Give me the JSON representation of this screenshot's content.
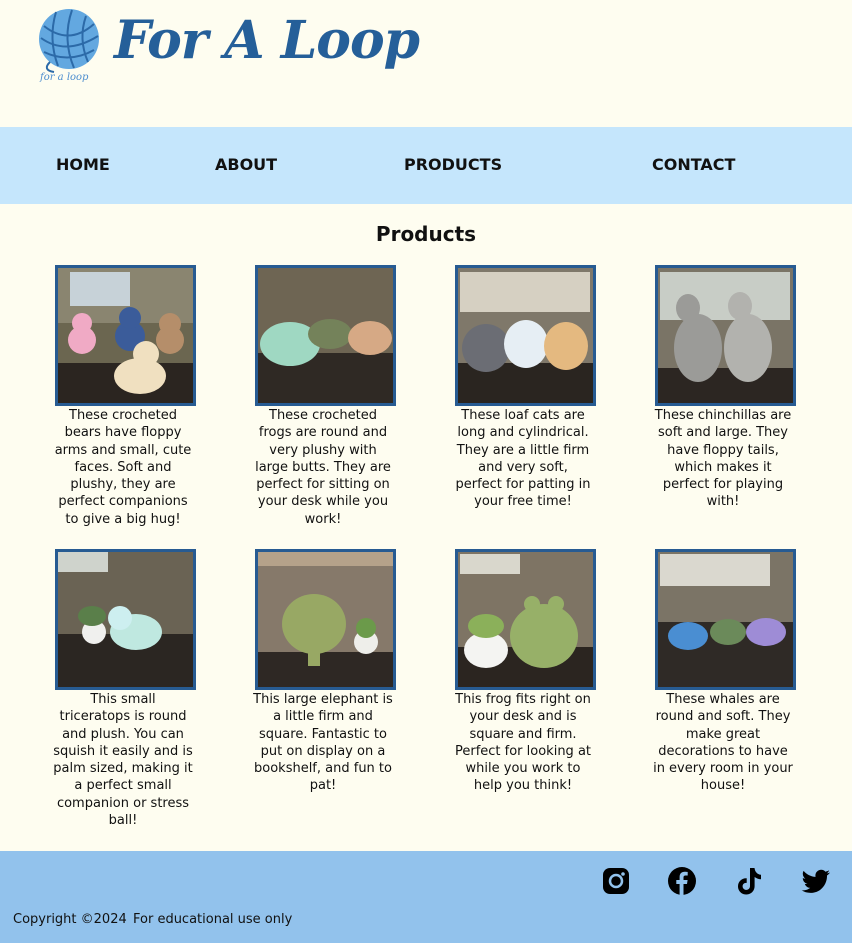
{
  "brand": {
    "name": "For A Loop",
    "logo_text": "for a loop"
  },
  "nav": {
    "home": "HOME",
    "about": "ABOUT",
    "products": "PRODUCTS",
    "contact": "CONTACT"
  },
  "products": {
    "title": "Products",
    "items": [
      {
        "desc": "These crocheted bears have floppy arms and small, cute faces. Soft and plushy, they are perfect companions to give a big hug!"
      },
      {
        "desc": "These crocheted frogs are round and very plushy with large butts. They are perfect for sitting on your desk while you work!"
      },
      {
        "desc": "These loaf cats are long and cylindrical. They are a little firm and very soft, perfect for patting in your free time!"
      },
      {
        "desc": "These chinchillas are soft and large. They have floppy tails, which makes it perfect for playing with!"
      },
      {
        "desc": "This small triceratops is round and plush. You can squish it easily and is palm sized, making it a perfect small companion or stress ball!"
      },
      {
        "desc": "This large elephant is a little firm and square. Fantastic to put on display on a bookshelf, and fun to pat!"
      },
      {
        "desc": "This frog fits right on your desk and is square and firm. Perfect for looking at while you work to help you think!"
      },
      {
        "desc": "These whales are round and soft. They make great decorations to have in every room in your house!"
      }
    ]
  },
  "footer": {
    "copyright": "Copyright ©2024",
    "note": "For educational use only",
    "social_icons": [
      "instagram-icon",
      "facebook-icon",
      "tiktok-icon",
      "twitter-icon"
    ]
  },
  "colors": {
    "background": "#fefdf0",
    "nav": "#c5e6fc",
    "footer": "#92c2ec",
    "brand": "#255f99",
    "frame": "#275b92"
  }
}
